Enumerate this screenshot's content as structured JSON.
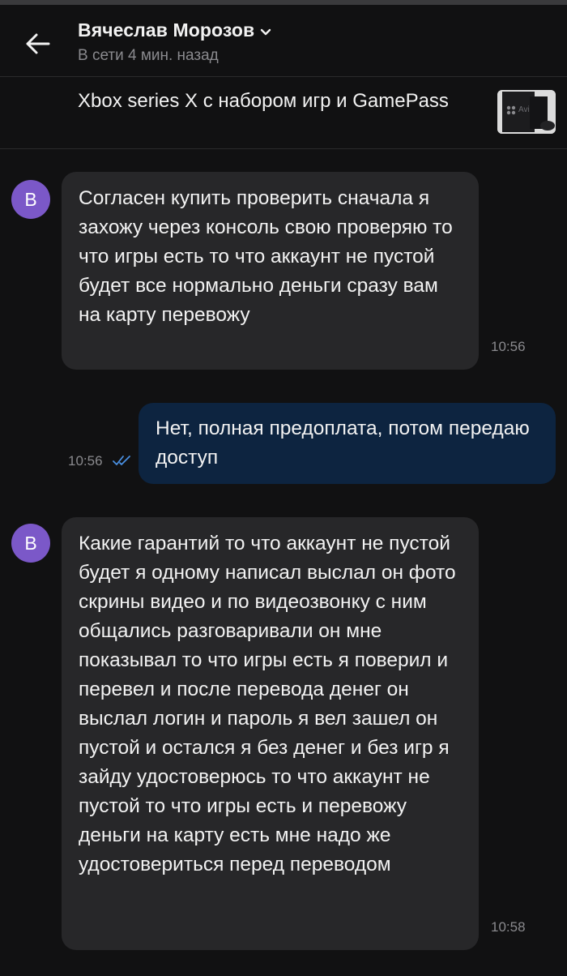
{
  "header": {
    "contact_name": "Вячеслав Морозов",
    "status": "В сети 4 мин. назад"
  },
  "listing": {
    "title": "Xbox series X с набором игр и GamePass",
    "thumb_text": "Avi"
  },
  "messages": [
    {
      "direction": "incoming",
      "avatar_letter": "В",
      "text": "Согласен купить проверить сначала я захожу через консоль свою проверяю то что игры есть то что аккаунт не пустой будет все нормально деньги сразу вам на карту перевожу",
      "time": "10:56"
    },
    {
      "direction": "outgoing",
      "text": "Нет, полная предоплата, потом передаю доступ",
      "time": "10:56",
      "read": true
    },
    {
      "direction": "incoming",
      "avatar_letter": "В",
      "text": "Какие гарантий то что аккаунт не пустой будет я одному написал выслал он фото скрины видео и по видеозвонку с ним общались разговаривали он мне показывал то что игры есть я поверил и перевел и после перевода денег он выслал логин и пароль я вел зашел он пустой и остался я без денег и без игр я зайду удостоверюсь то что аккаунт не пустой то что игры есть и перевожу деньги на карту есть мне надо же удостовериться перед переводом",
      "time": "10:58"
    }
  ],
  "colors": {
    "background": "#111112",
    "incoming_bubble": "#272729",
    "outgoing_bubble": "#0d2440",
    "avatar": "#7b58c8",
    "read_checks": "#4a90e2",
    "muted_text": "#8a8a8e"
  },
  "icons": {
    "back": "arrow-left-icon",
    "dropdown": "chevron-down-icon",
    "read_receipt": "double-check-icon"
  }
}
